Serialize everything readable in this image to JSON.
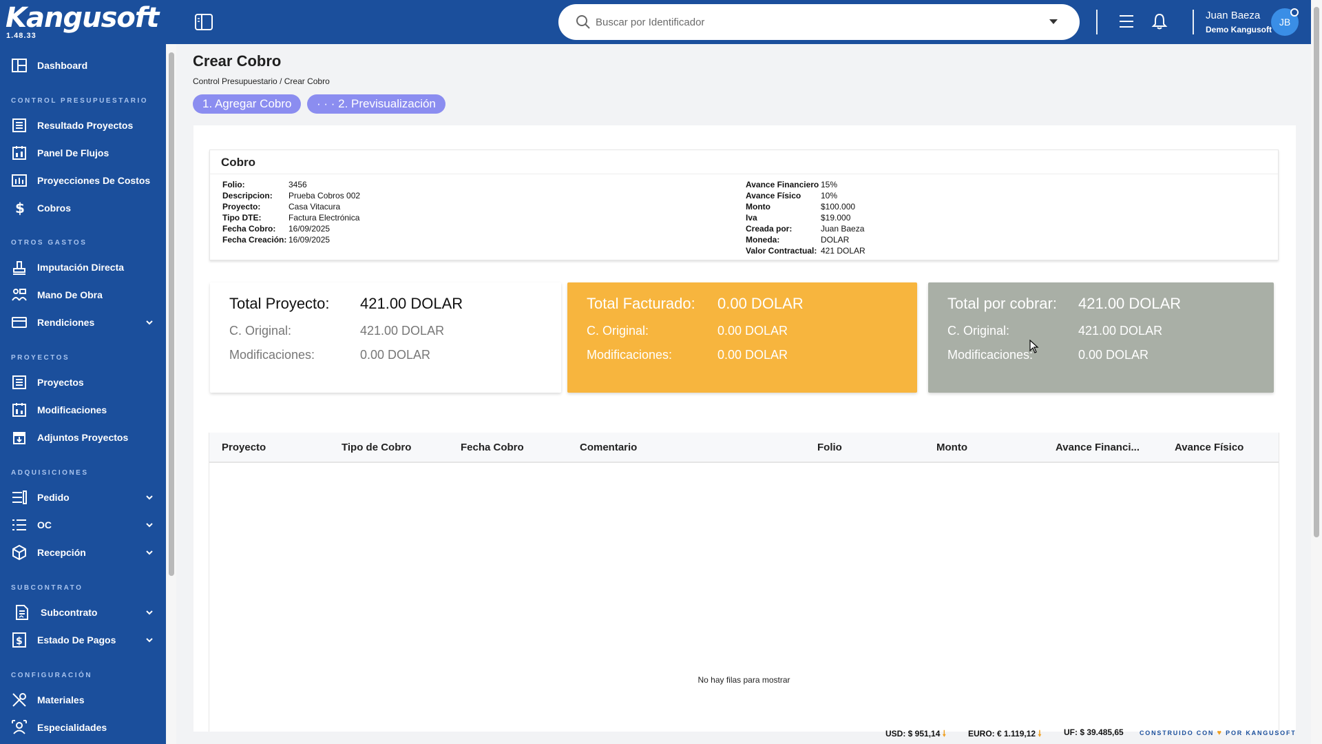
{
  "brand": {
    "name": "Kangusoft",
    "version": "1.48.33"
  },
  "search": {
    "placeholder": "Buscar por Identificador"
  },
  "user": {
    "name": "Juan Baeza",
    "company": "Demo Kangusoft",
    "initials": "JB"
  },
  "sidebar": {
    "dashboard": "Dashboard",
    "sections": {
      "control": "CONTROL PRESUPUESTARIO",
      "otros": "OTROS GASTOS",
      "proyectos": "PROYECTOS",
      "adquisiciones": "ADQUISICIONES",
      "subcontrato": "SUBCONTRATO",
      "configuracion": "CONFIGURACIÓN"
    },
    "items": {
      "resultado_proyectos": "Resultado Proyectos",
      "panel_flujos": "Panel De Flujos",
      "proyecciones_costos": "Proyecciones De Costos",
      "cobros": "Cobros",
      "imputacion_directa": "Imputación Directa",
      "mano_obra": "Mano De Obra",
      "rendiciones": "Rendiciones",
      "proyectos": "Proyectos",
      "modificaciones": "Modificaciones",
      "adjuntos_proyectos": "Adjuntos Proyectos",
      "pedido": "Pedido",
      "oc": "OC",
      "recepcion": "Recepción",
      "subcontrato": "Subcontrato",
      "estado_pagos": "Estado De Pagos",
      "materiales": "Materiales",
      "especialidades": "Especialidades"
    }
  },
  "page": {
    "title": "Crear Cobro",
    "breadcrumb": "Control Presupuestario / Crear Cobro",
    "steps": [
      "1. Agregar Cobro",
      "· · · 2. Previsualización"
    ]
  },
  "cobro": {
    "title": "Cobro",
    "left": [
      {
        "k": "Folio:",
        "v": "3456"
      },
      {
        "k": "Descripcion:",
        "v": "Prueba Cobros 002"
      },
      {
        "k": "Proyecto:",
        "v": "Casa Vitacura"
      },
      {
        "k": "Tipo DTE:",
        "v": "Factura Electrónica"
      },
      {
        "k": "Fecha Cobro:",
        "v": "16/09/2025"
      },
      {
        "k": "Fecha Creación:",
        "v": "16/09/2025"
      }
    ],
    "right": [
      {
        "k": "Avance Financiero",
        "v": "15%"
      },
      {
        "k": "Avance Físico",
        "v": "10%"
      },
      {
        "k": "Monto",
        "v": "$100.000"
      },
      {
        "k": "Iva",
        "v": "$19.000"
      },
      {
        "k": "Creada por:",
        "v": "Juan Baeza"
      },
      {
        "k": "Moneda:",
        "v": "DOLAR"
      },
      {
        "k": "Valor Contractual:",
        "v": "421 DOLAR"
      }
    ]
  },
  "summary": [
    {
      "title": "Total Proyecto:",
      "total": "421.00 DOLAR",
      "orig_label": "C. Original:",
      "orig": "421.00 DOLAR",
      "mod_label": "Modificaciones:",
      "mod": "0.00 DOLAR",
      "color": "#ffffff"
    },
    {
      "title": "Total Facturado:",
      "total": "0.00 DOLAR",
      "orig_label": "C. Original:",
      "orig": "0.00 DOLAR",
      "mod_label": "Modificaciones:",
      "mod": "0.00 DOLAR",
      "color": "#f7b53e"
    },
    {
      "title": "Total por cobrar:",
      "total": "421.00 DOLAR",
      "orig_label": "C. Original:",
      "orig": "421.00 DOLAR",
      "mod_label": "Modificaciones:",
      "mod": "0.00 DOLAR",
      "color": "#a9afa6"
    }
  ],
  "table": {
    "columns": [
      "Proyecto",
      "Tipo de Cobro",
      "Fecha Cobro",
      "Comentario",
      "Folio",
      "Monto",
      "Avance Financi...",
      "Avance Físico"
    ],
    "empty": "No hay filas para mostrar"
  },
  "footer": {
    "usd": "USD: $ 951,14",
    "euro": "EURO: € 1.119,12",
    "uf": "UF: $ 39.485,65",
    "built_a": "CONSTRUIDO CON",
    "built_b": "POR KANGUSOFT"
  },
  "colors": {
    "primary": "#1b4f9c",
    "step": "#8b8df0",
    "facturado": "#f7b53e",
    "por_cobrar": "#a9afa6"
  }
}
